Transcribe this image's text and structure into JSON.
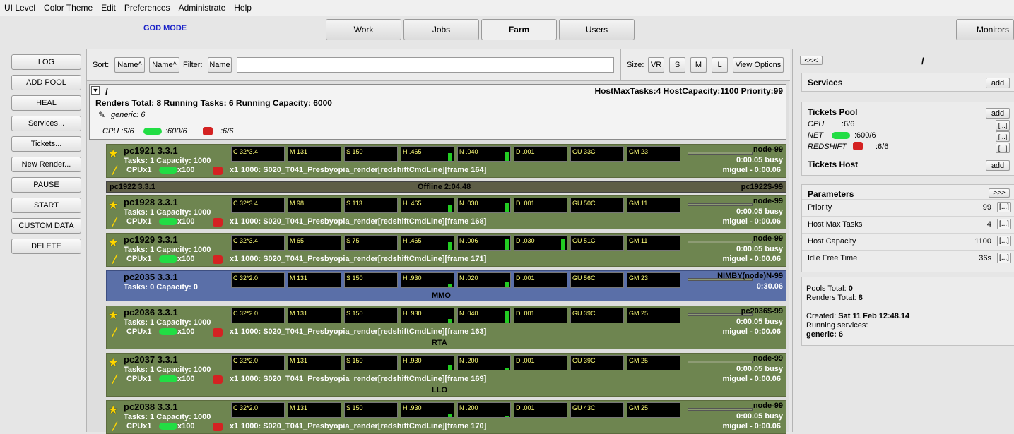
{
  "menu": [
    "UI Level",
    "Color Theme",
    "Edit",
    "Preferences",
    "Administrate",
    "Help"
  ],
  "god_mode": "GOD MODE",
  "tabs": {
    "work": "Work",
    "jobs": "Jobs",
    "farm": "Farm",
    "users": "Users",
    "monitors": "Monitors"
  },
  "left_buttons": {
    "log": "LOG",
    "add_pool": "ADD POOL",
    "heal": "HEAL",
    "services": "Services...",
    "tickets": "Tickets...",
    "new_render": "New Render...",
    "pause": "PAUSE",
    "start": "START",
    "custom_data": "CUSTOM DATA",
    "delete": "DELETE"
  },
  "sortbar": {
    "sort_label": "Sort:",
    "sort1": "Name^",
    "sort2": "Name^",
    "filter_label": "Filter:",
    "filter_btn": "Name",
    "filter_value": "",
    "size_label": "Size:",
    "vr": "VR",
    "s": "S",
    "m": "M",
    "l": "L",
    "view_options": "View Options"
  },
  "pool": {
    "expand": "▼",
    "name": "/",
    "caps": "HostMaxTasks:4 HostCapacity:1100 Priority:99",
    "summary": "Renders Total: 8 Running Tasks: 6 Running Capacity: 6000",
    "service": "generic: 6",
    "cpu": "CPU :6/6",
    "net": ":600/6",
    "red": ":6/6"
  },
  "offline": {
    "name": "pc1922 3.3.1",
    "status": "Offline 2:04.48",
    "right": "pc1922$-99"
  },
  "renders": [
    {
      "name": "pc1921 3.3.1",
      "tasks": "Tasks: 1 Capacity: 1000",
      "state": "node-99",
      "busy": "0:00.05 busy",
      "c": "C 32*3.4",
      "m": "M 131",
      "s": "S 150",
      "h": "H .465",
      "n": "N .040",
      "d": "D .001",
      "gu": "GU 33C",
      "gm": "GM 23",
      "cpux": "CPUx1",
      "netx": "x100",
      "redx": "x1",
      "job": "1000: S020_T041_Presbyopia_render[redshiftCmdLine][frame 164]",
      "user": "miguel - 0:00.06",
      "tag": "",
      "nimby": false,
      "h_lvl": 0.6,
      "n_lvl": 0.7,
      "d_lvl": 0.0
    },
    {
      "name": "pc1928 3.3.1",
      "tasks": "Tasks: 1 Capacity: 1000",
      "state": "node-99",
      "busy": "0:00.05 busy",
      "c": "C 32*3.4",
      "m": "M 98",
      "s": "S 113",
      "h": "H .465",
      "n": "N .030",
      "d": "D .001",
      "gu": "GU 50C",
      "gm": "GM 11",
      "cpux": "CPUx1",
      "netx": "x100",
      "redx": "x1",
      "job": "1000: S020_T041_Presbyopia_render[redshiftCmdLine][frame 168]",
      "user": "miguel - 0:00.06",
      "tag": "",
      "nimby": false,
      "h_lvl": 0.6,
      "n_lvl": 0.8,
      "d_lvl": 0.0
    },
    {
      "name": "pc1929 3.3.1",
      "tasks": "Tasks: 1 Capacity: 1000",
      "state": "node-99",
      "busy": "0:00.05 busy",
      "c": "C 32*3.4",
      "m": "M 65",
      "s": "S 75",
      "h": "H .465",
      "n": "N .006",
      "d": "D .030",
      "gu": "GU 51C",
      "gm": "GM 11",
      "cpux": "CPUx1",
      "netx": "x100",
      "redx": "x1",
      "job": "1000: S020_T041_Presbyopia_render[redshiftCmdLine][frame 171]",
      "user": "miguel - 0:00.06",
      "tag": "",
      "nimby": false,
      "h_lvl": 0.6,
      "n_lvl": 0.9,
      "d_lvl": 0.9
    },
    {
      "name": "pc2035 3.3.1",
      "tasks": "Tasks: 0 Capacity: 0",
      "state": "NIMBY(node)N-99",
      "busy": "0:30.06",
      "c": "C 32*2.0",
      "m": "M 131",
      "s": "S 150",
      "h": "H .930",
      "n": "N .020",
      "d": "D .001",
      "gu": "GU 56C",
      "gm": "GM 23",
      "cpux": "",
      "netx": "",
      "redx": "",
      "job": "",
      "user": "",
      "tag": "MMO",
      "nimby": true,
      "h_lvl": 0.3,
      "n_lvl": 0.4,
      "d_lvl": 0.0
    },
    {
      "name": "pc2036 3.3.1",
      "tasks": "Tasks: 1 Capacity: 1000",
      "state": "pc2036$-99",
      "busy": "0:00.05 busy",
      "c": "C 32*2.0",
      "m": "M 131",
      "s": "S 150",
      "h": "H .930",
      "n": "N .040",
      "d": "D .001",
      "gu": "GU 39C",
      "gm": "GM 25",
      "cpux": "CPUx1",
      "netx": "x100",
      "redx": "x1",
      "job": "1000: S020_T041_Presbyopia_render[redshiftCmdLine][frame 163]",
      "user": "miguel - 0:00.06",
      "tag": "RTA",
      "nimby": false,
      "h_lvl": 0.3,
      "n_lvl": 0.9,
      "d_lvl": 0.0
    },
    {
      "name": "pc2037 3.3.1",
      "tasks": "Tasks: 1 Capacity: 1000",
      "state": "node-99",
      "busy": "0:00.05 busy",
      "c": "C 32*2.0",
      "m": "M 131",
      "s": "S 150",
      "h": "H .930",
      "n": "N .200",
      "d": "D .001",
      "gu": "GU 39C",
      "gm": "GM 25",
      "cpux": "CPUx1",
      "netx": "x100",
      "redx": "x1",
      "job": "1000: S020_T041_Presbyopia_render[redshiftCmdLine][frame 169]",
      "user": "miguel - 0:00.06",
      "tag": "LLO",
      "nimby": false,
      "h_lvl": 0.4,
      "n_lvl": 0.1,
      "d_lvl": 0.0
    },
    {
      "name": "pc2038 3.3.1",
      "tasks": "Tasks: 1 Capacity: 1000",
      "state": "node-99",
      "busy": "0:00.05 busy",
      "c": "C 32*2.0",
      "m": "M 131",
      "s": "S 150",
      "h": "H .930",
      "n": "N .200",
      "d": "D .001",
      "gu": "GU 43C",
      "gm": "GM 25",
      "cpux": "CPUx1",
      "netx": "x100",
      "redx": "x1",
      "job": "1000: S020_T041_Presbyopia_render[redshiftCmdLine][frame 170]",
      "user": "miguel - 0:00.06",
      "tag": "",
      "nimby": false,
      "h_lvl": 0.3,
      "n_lvl": 0.1,
      "d_lvl": 0.0
    }
  ],
  "right": {
    "back": "<<<",
    "title": "/",
    "services": "Services",
    "add": "add",
    "tickets_pool": "Tickets Pool",
    "t_cpu": "CPU",
    "t_cpu_v": ":6/6",
    "t_net": "NET",
    "t_net_v": ":600/6",
    "t_red": "REDSHIFT",
    "t_red_v": ":6/6",
    "dots": "[...]",
    "tickets_host": "Tickets Host",
    "parameters": "Parameters",
    "fwd": ">>>",
    "params": [
      {
        "label": "Priority",
        "value": "99"
      },
      {
        "label": "Host Max Tasks",
        "value": "4"
      },
      {
        "label": "Host Capacity",
        "value": "1100"
      },
      {
        "label": "Idle Free Time",
        "value": "36s"
      }
    ],
    "pools_total_label": "Pools Total:",
    "pools_total": "0",
    "renders_total_label": "Renders Total:",
    "renders_total": "8",
    "created_label": "Created:",
    "created": "Sat 11 Feb 12:48.14",
    "running_label": "Running services:",
    "running": "generic: 6"
  }
}
